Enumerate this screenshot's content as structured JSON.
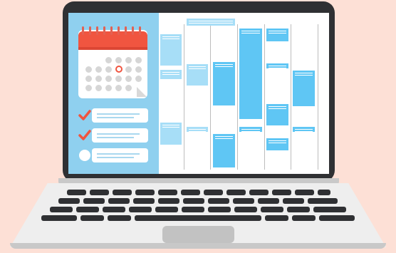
{
  "illustration": {
    "subject": "laptop-with-calendar-app",
    "colors": {
      "background": "#fde0d6",
      "laptop_body": "#2f3033",
      "side_panel": "#8fd0ef",
      "calendar_header": "#f05540",
      "event_block": "#5fc6f4",
      "event_block_pale": "#a7def7",
      "check_mark": "#f05540",
      "keyboard_deck": "#eeeeee"
    },
    "checklist": [
      {
        "state": "checked"
      },
      {
        "state": "checked"
      },
      {
        "state": "unchecked"
      }
    ],
    "icons": {
      "calendar": "calendar-icon",
      "check": "checkmark-icon",
      "empty": "empty-circle-icon"
    }
  }
}
